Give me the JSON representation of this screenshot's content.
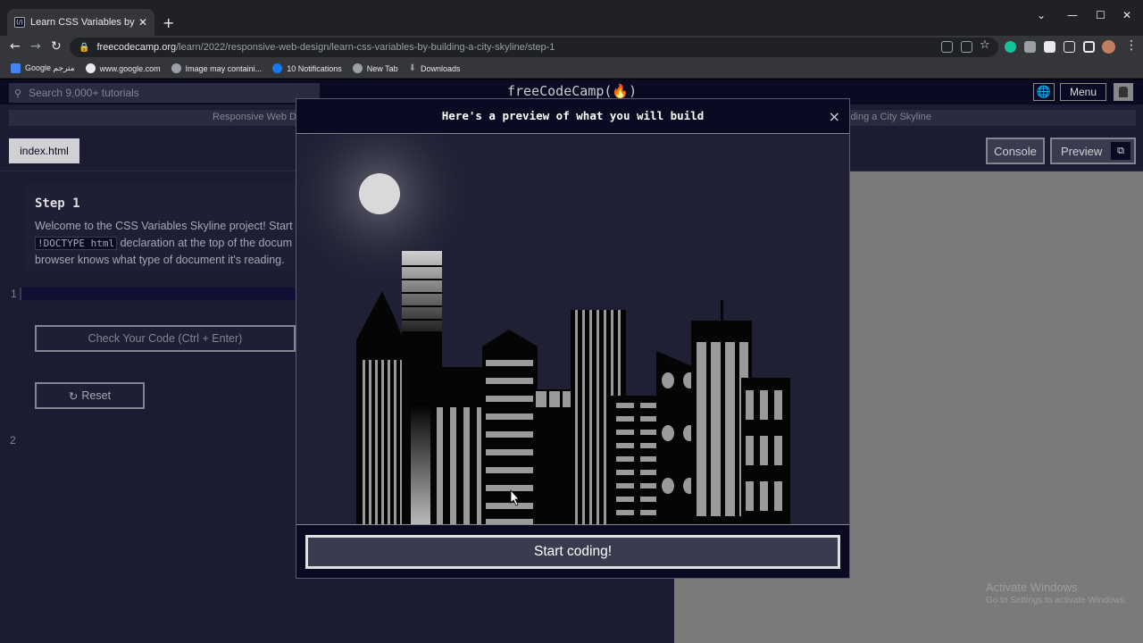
{
  "browser": {
    "tab_title": "Learn CSS Variables by Building a",
    "tab_favicon": "(/)",
    "url_domain": "freecodecamp.org",
    "url_path": "/learn/2022/responsive-web-design/learn-css-variables-by-building-a-city-skyline/step-1",
    "bookmarks": [
      {
        "label": "Google مترجم",
        "icon": "translate-icon",
        "color": "#4285f4"
      },
      {
        "label": "www.google.com",
        "icon": "google-icon",
        "color": "#e8eaed"
      },
      {
        "label": "Image may containi...",
        "icon": "globe-icon",
        "color": "#9aa0a6"
      },
      {
        "label": "10 Notifications",
        "icon": "facebook-icon",
        "color": "#1877f2"
      },
      {
        "label": "New Tab",
        "icon": "globe-icon",
        "color": "#9aa0a6"
      },
      {
        "label": "Downloads",
        "icon": "download-icon",
        "color": "#9aa0a6"
      }
    ]
  },
  "nav": {
    "search_placeholder": "Search 9,000+ tutorials",
    "logo": "freeCodeCamp(🔥)",
    "menu_label": "Menu"
  },
  "breadcrumb": {
    "left": "Responsive Web De",
    "right": "lding a City Skyline"
  },
  "editor": {
    "file_tab": "index.html",
    "console_label": "Console",
    "preview_label": "Preview",
    "step_title": "Step 1",
    "step_text_1": "Welcome to the CSS Variables Skyline project! Start b",
    "step_code": "!DOCTYPE html",
    "step_text_2": " declaration at the top of the docum",
    "step_text_3": "browser knows what type of document it's reading.",
    "line1": "1",
    "line2": "2",
    "check_label": "Check Your Code (Ctrl + Enter)",
    "reset_label": "Reset"
  },
  "modal": {
    "title": "Here's a preview of what you will build",
    "close": "×",
    "start_label": "Start coding!"
  },
  "watermark": {
    "line1": "Activate Windows",
    "line2": "Go to Settings to activate Windows."
  },
  "colors": {
    "fcc_dark": "#0a0a23",
    "fcc_bg": "#1b1b32",
    "sky": "#1f2033",
    "moon": "#d9d9d9",
    "building_black": "#050505",
    "window_gray": "#9a9a9a"
  }
}
